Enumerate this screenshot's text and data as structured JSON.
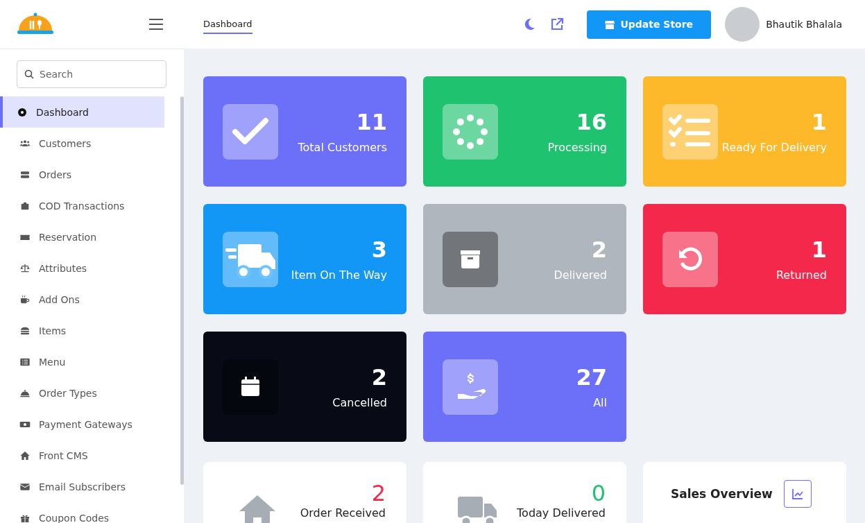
{
  "header": {
    "tabs": [
      {
        "label": "Dashboard",
        "selected": true
      }
    ],
    "button": "Update Store",
    "user": "Bhautik Bhalala"
  },
  "sidebar": {
    "search": {
      "placeholder": "Search"
    },
    "items": [
      {
        "label": "Dashboard",
        "kind": "dashboard",
        "selected": true
      },
      {
        "label": "Customers",
        "kind": "users",
        "selected": false
      },
      {
        "label": "Orders",
        "kind": "orders",
        "selected": false
      },
      {
        "label": "COD Transactions",
        "kind": "case",
        "selected": false
      },
      {
        "label": "Reservation",
        "kind": "ticket",
        "selected": false
      },
      {
        "label": "Attributes",
        "kind": "scale",
        "selected": false
      },
      {
        "label": "Add Ons",
        "kind": "mug",
        "selected": false
      },
      {
        "label": "Items",
        "kind": "burger",
        "selected": false
      },
      {
        "label": "Menu",
        "kind": "list",
        "selected": false
      },
      {
        "label": "Order Types",
        "kind": "cloche",
        "selected": false
      },
      {
        "label": "Payment Gateways",
        "kind": "bill",
        "selected": false
      },
      {
        "label": "Front CMS",
        "kind": "house",
        "selected": false
      },
      {
        "label": "Email Subscribers",
        "kind": "mail",
        "selected": false
      },
      {
        "label": "Coupon Codes",
        "kind": "gift",
        "selected": false
      }
    ]
  },
  "stats": [
    {
      "value": "11",
      "label": "Total Customers",
      "kind": "check",
      "color": "#6c6ff8"
    },
    {
      "value": "16",
      "label": "Processing",
      "kind": "spinner",
      "color": "#1ec26f"
    },
    {
      "value": "1",
      "label": "Ready For Delivery",
      "kind": "checklist",
      "color": "#fdb92a"
    },
    {
      "value": "3",
      "label": "Item On The Way",
      "kind": "truck",
      "color": "#1297f7"
    },
    {
      "value": "2",
      "label": "Delivered",
      "kind": "box",
      "color": "#b0b6bd"
    },
    {
      "value": "1",
      "label": "Returned",
      "kind": "undo",
      "color": "#f4284a"
    },
    {
      "value": "2",
      "label": "Cancelled",
      "kind": "calendar",
      "color": "#080b16"
    },
    {
      "value": "27",
      "label": "All",
      "kind": "hand",
      "color": "#6c6ff8"
    }
  ],
  "summary": [
    {
      "kind": "received",
      "value": "2",
      "label": "Order Received",
      "color": "#f4284a"
    },
    {
      "kind": "delivered",
      "value": "0",
      "label": "Today Delivered",
      "color": "#1ec26f"
    },
    {
      "kind": "title",
      "label": "Sales Overview"
    }
  ]
}
